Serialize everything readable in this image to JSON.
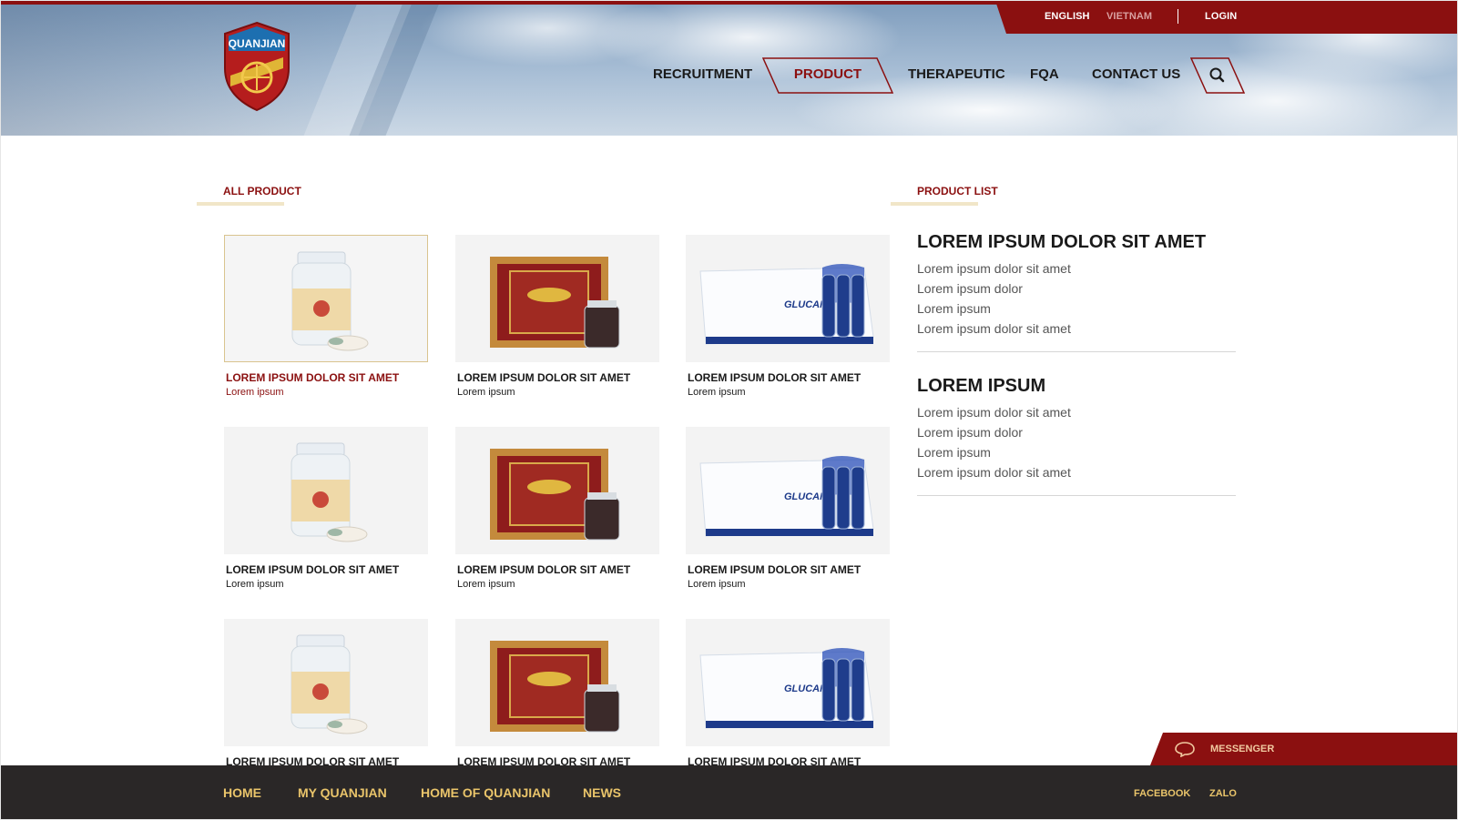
{
  "brand": {
    "logo_text": "QUANJIAN"
  },
  "topbar": {
    "lang_english": "ENGLISH",
    "lang_vietnam": "VIETNAM",
    "login": "LOGIN"
  },
  "nav": {
    "items": [
      "RECRUITMENT",
      "PRODUCT",
      "THERAPEUTIC",
      "FQA",
      "CONTACT US"
    ],
    "active": "PRODUCT",
    "search_icon": "search-icon"
  },
  "colors": {
    "brand_red": "#8b1010",
    "gold": "#e9c46a",
    "footer_bg": "#2a2727"
  },
  "all_product": {
    "title": "ALL PRODUCT",
    "products": [
      {
        "name": "LOREM IPSUM DOLOR SIT AMET",
        "sub": "Lorem ipsum",
        "image": "bottle",
        "active": true
      },
      {
        "name": "LOREM IPSUM DOLOR SIT AMET",
        "sub": "Lorem ipsum",
        "image": "gift-box",
        "active": false
      },
      {
        "name": "LOREM IPSUM DOLOR SIT AMET",
        "sub": "Lorem ipsum",
        "image": "glucan-box",
        "active": false
      },
      {
        "name": "LOREM IPSUM DOLOR SIT AMET",
        "sub": "Lorem ipsum",
        "image": "bottle",
        "active": false
      },
      {
        "name": "LOREM IPSUM DOLOR SIT AMET",
        "sub": "Lorem ipsum",
        "image": "gift-box",
        "active": false
      },
      {
        "name": "LOREM IPSUM DOLOR SIT AMET",
        "sub": "Lorem ipsum",
        "image": "glucan-box",
        "active": false
      },
      {
        "name": "LOREM IPSUM DOLOR SIT AMET",
        "sub": "",
        "image": "bottle",
        "active": false
      },
      {
        "name": "LOREM IPSUM DOLOR SIT AMET",
        "sub": "",
        "image": "gift-box",
        "active": false
      },
      {
        "name": "LOREM IPSUM DOLOR SIT AMET",
        "sub": "",
        "image": "glucan-box",
        "active": false
      }
    ]
  },
  "product_list": {
    "title": "PRODUCT LIST",
    "groups": [
      {
        "heading": "LOREM IPSUM DOLOR SIT AMET",
        "items": [
          "Lorem ipsum dolor sit amet",
          "Lorem ipsum dolor",
          "Lorem ipsum",
          "Lorem ipsum dolor sit amet"
        ]
      },
      {
        "heading": "LOREM IPSUM",
        "items": [
          "Lorem ipsum dolor sit amet",
          "Lorem ipsum dolor",
          "Lorem ipsum",
          "Lorem ipsum dolor sit amet"
        ]
      }
    ]
  },
  "messenger": {
    "label": "MESSENGER",
    "icon": "chat-bubble-icon"
  },
  "footer": {
    "links": [
      "HOME",
      "MY QUANJIAN",
      "HOME OF QUANJIAN",
      "NEWS"
    ],
    "social": [
      "FACEBOOK",
      "ZALO"
    ]
  }
}
